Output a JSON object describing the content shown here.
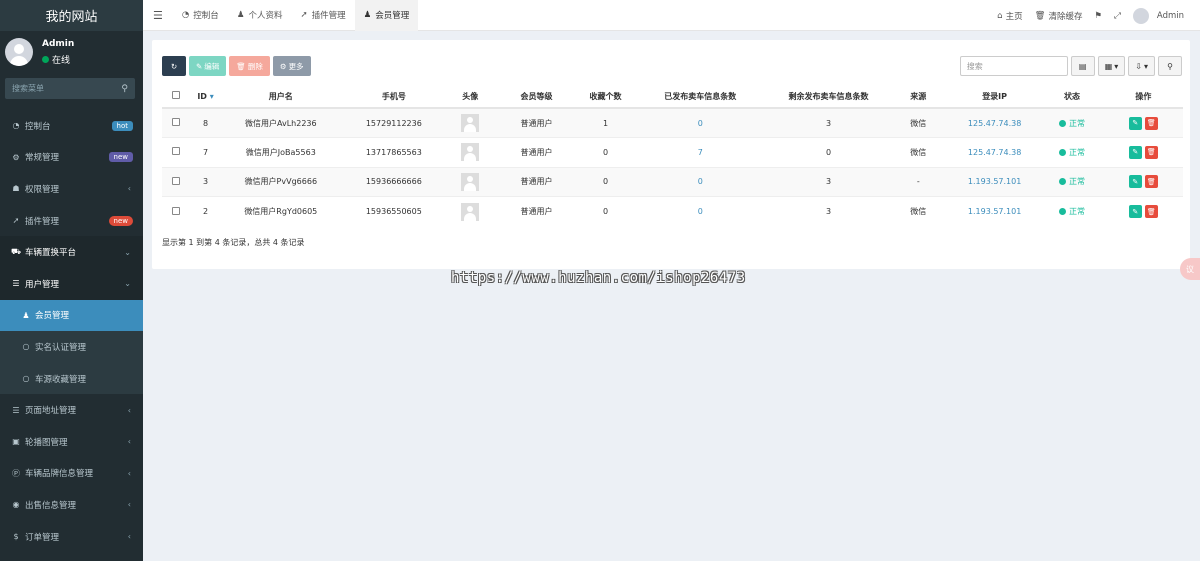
{
  "site_title": "我的网站",
  "user": {
    "name": "Admin",
    "status": "在线"
  },
  "sidebar_search_placeholder": "搜索菜单",
  "sidebar": [
    {
      "label": "控制台",
      "icon": "dashboard-icon",
      "badge": "hot",
      "badge_color": "#3c8dbc"
    },
    {
      "label": "常规管理",
      "icon": "cogs-icon",
      "badge": "new",
      "badge_color": "#605ca8"
    },
    {
      "label": "权限管理",
      "icon": "group-icon",
      "chevron": "‹"
    },
    {
      "label": "插件管理",
      "icon": "rocket-icon",
      "badge": "new",
      "badge_color": "#dd4b39",
      "badge_round": true
    },
    {
      "label": "车辆置换平台",
      "icon": "car-icon",
      "chevron": "⌄",
      "active": true
    },
    {
      "label": "用户管理",
      "icon": "list-icon",
      "chevron": "⌄",
      "active": true
    },
    {
      "label": "会员管理",
      "icon": "user-icon",
      "sub": true,
      "current": true
    },
    {
      "label": "实名认证管理",
      "icon": "circle-icon",
      "sub": true
    },
    {
      "label": "车源收藏管理",
      "icon": "circle-icon",
      "sub": true
    },
    {
      "label": "页面地址管理",
      "icon": "bars-icon",
      "chevron": "‹"
    },
    {
      "label": "轮播图管理",
      "icon": "image-icon",
      "chevron": "‹"
    },
    {
      "label": "车辆品牌信息管理",
      "icon": "product-hunt-icon",
      "chevron": "‹"
    },
    {
      "label": "出售信息管理",
      "icon": "eye-icon",
      "chevron": "‹"
    },
    {
      "label": "订单管理",
      "icon": "dollar-icon",
      "chevron": "‹"
    }
  ],
  "tabs": [
    {
      "label": "控制台",
      "icon": "dashboard-icon"
    },
    {
      "label": "个人资料",
      "icon": "user-icon"
    },
    {
      "label": "插件管理",
      "icon": "rocket-icon"
    },
    {
      "label": "会员管理",
      "icon": "user-icon",
      "active": true
    }
  ],
  "topright": {
    "home": "主页",
    "clear_cache": "清除缓存",
    "username": "Admin"
  },
  "toolbar": {
    "edit": "编辑",
    "delete": "删除",
    "more": "更多",
    "search_placeholder": "搜索"
  },
  "table": {
    "columns": [
      "ID",
      "用户名",
      "手机号",
      "头像",
      "会员等级",
      "收藏个数",
      "已发布卖车信息条数",
      "剩余发布卖车信息条数",
      "来源",
      "登录IP",
      "状态",
      "操作"
    ],
    "rows": [
      {
        "id": "8",
        "username": "微信用户AvLh2236",
        "phone": "15729112236",
        "level": "普通用户",
        "favorites": "1",
        "published": "0",
        "remaining": "3",
        "source": "微信",
        "ip": "125.47.74.38",
        "status": "正常"
      },
      {
        "id": "7",
        "username": "微信用户JoBa5563",
        "phone": "13717865563",
        "level": "普通用户",
        "favorites": "0",
        "published": "7",
        "remaining": "0",
        "source": "微信",
        "ip": "125.47.74.38",
        "status": "正常"
      },
      {
        "id": "3",
        "username": "微信用户PvVg6666",
        "phone": "15936666666",
        "level": "普通用户",
        "favorites": "0",
        "published": "0",
        "remaining": "3",
        "source": "-",
        "ip": "1.193.57.101",
        "status": "正常"
      },
      {
        "id": "2",
        "username": "微信用户RgYd0605",
        "phone": "15936550605",
        "level": "普通用户",
        "favorites": "0",
        "published": "0",
        "remaining": "3",
        "source": "微信",
        "ip": "1.193.57.101",
        "status": "正常"
      }
    ]
  },
  "pagination_text": "显示第 1 到第 4 条记录，总共 4 条记录",
  "watermark_url": "https://www.huzhan.com/ishop26473",
  "float_badge": "议"
}
